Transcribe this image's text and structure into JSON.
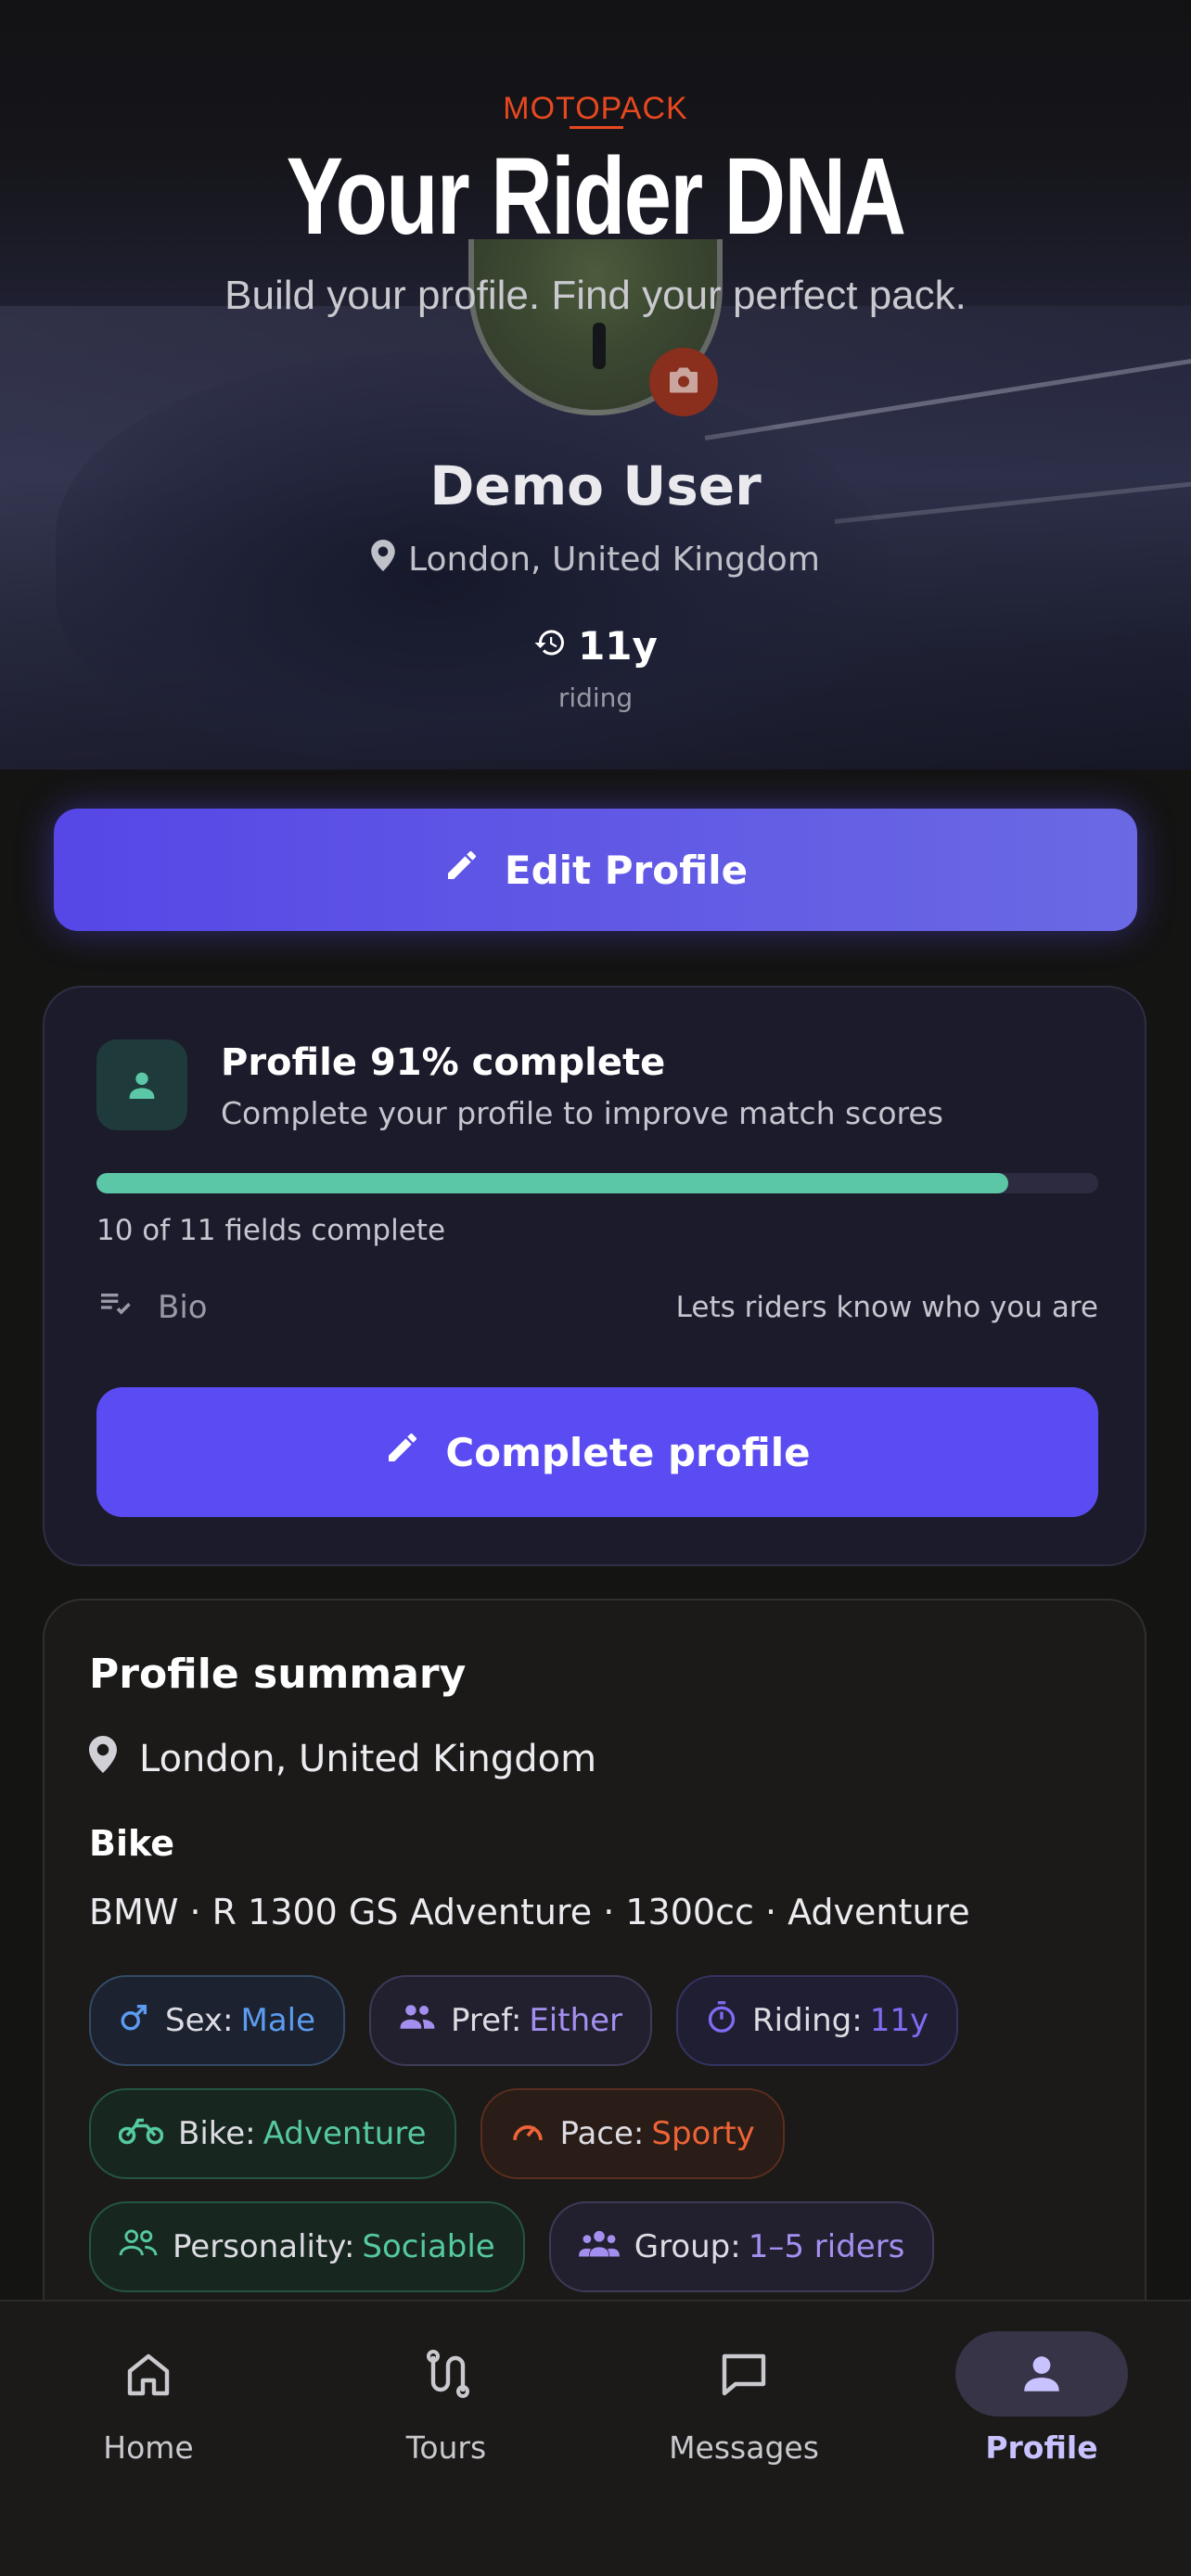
{
  "hero": {
    "brand": "MOTOPACK",
    "title": "Your Rider DNA",
    "subtitle": "Build your profile. Find your perfect pack.",
    "user_name": "Demo User",
    "location": "London, United Kingdom",
    "riding_value": "11y",
    "riding_label": "riding"
  },
  "edit_button": {
    "label": "Edit Profile"
  },
  "completion": {
    "title": "Profile 91% complete",
    "description": "Complete your profile to improve match scores",
    "progress_fraction": 0.91,
    "fields_count": "10 of 11 fields complete",
    "missing_field_label": "Bio",
    "missing_field_hint": "Lets riders know who you are",
    "button_label": "Complete profile"
  },
  "summary": {
    "title": "Profile summary",
    "location": "London, United Kingdom",
    "bike_heading": "Bike",
    "bike_details": "BMW · R 1300 GS Adventure · 1300cc · Adventure",
    "chips": [
      {
        "key": "Sex:",
        "value": "Male",
        "icon": "male-icon",
        "color": "#5b9cf0"
      },
      {
        "key": "Pref:",
        "value": "Either",
        "icon": "people-icon",
        "color": "#a48ff0"
      },
      {
        "key": "Riding:",
        "value": "11y",
        "icon": "timer-icon",
        "color": "#7f6cf2"
      },
      {
        "key": "Bike:",
        "value": "Adventure",
        "icon": "motorcycle-icon",
        "color": "#55c9a0"
      },
      {
        "key": "Pace:",
        "value": "Sporty",
        "icon": "speedometer-icon",
        "color": "#ec6437"
      },
      {
        "key": "Personality:",
        "value": "Sociable",
        "icon": "group-outline-icon",
        "color": "#55c9a0"
      },
      {
        "key": "Group:",
        "value": "1–5 riders",
        "icon": "group-icon",
        "color": "#a48ff0"
      }
    ]
  },
  "tabs": [
    {
      "label": "Home",
      "icon": "home-icon",
      "active": false
    },
    {
      "label": "Tours",
      "icon": "route-icon",
      "active": false
    },
    {
      "label": "Messages",
      "icon": "message-icon",
      "active": false
    },
    {
      "label": "Profile",
      "icon": "person-icon",
      "active": true
    }
  ],
  "colors": {
    "accent": "#5a4cf2",
    "brand": "#e8481f",
    "progress": "#5cc7a7"
  }
}
